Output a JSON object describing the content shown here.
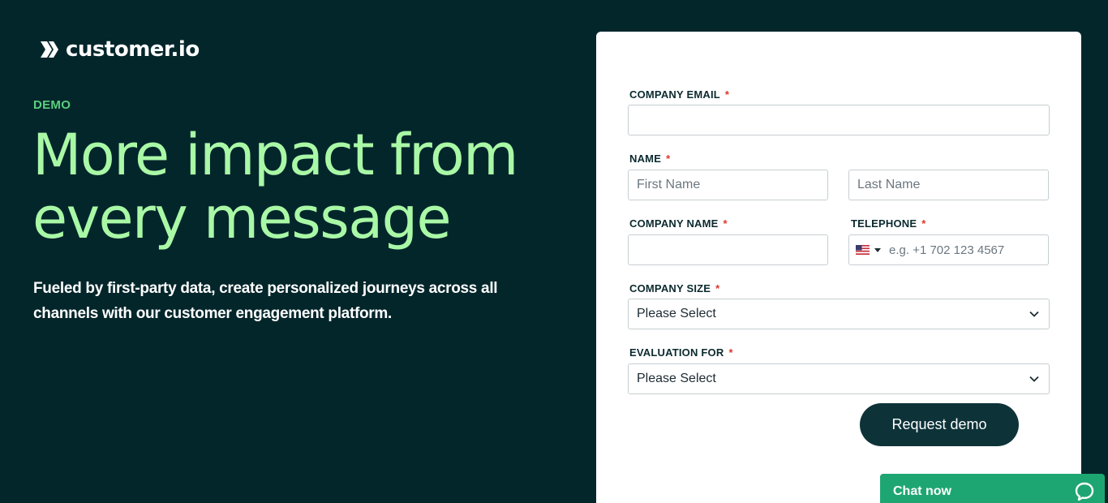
{
  "brand": {
    "name": "customer.io"
  },
  "hero": {
    "eyebrow": "DEMO",
    "headline_line1": "More impact from",
    "headline_line2": "every message",
    "subtext_line1": "Fueled by first-party data, create personalized journeys across all",
    "subtext_line2": "channels with our customer engagement platform."
  },
  "form": {
    "company_email": {
      "label": "COMPANY EMAIL",
      "required": "*",
      "value": ""
    },
    "name": {
      "label": "NAME",
      "required": "*",
      "first_placeholder": "First Name",
      "last_placeholder": "Last Name"
    },
    "company_name": {
      "label": "COMPANY NAME",
      "required": "*",
      "value": ""
    },
    "telephone": {
      "label": "TELEPHONE",
      "required": "*",
      "placeholder": "e.g. +1 702 123 4567",
      "country_flag": "us-flag-icon"
    },
    "company_size": {
      "label": "COMPANY SIZE",
      "required": "*",
      "selected": "Please Select"
    },
    "evaluation_for": {
      "label": "EVALUATION FOR",
      "required": "*",
      "selected": "Please Select"
    },
    "submit_label": "Request demo"
  },
  "chat": {
    "label": "Chat now",
    "icon": "chat-bubble-icon"
  },
  "colors": {
    "background": "#03262b",
    "headline": "#a9f8a6",
    "eyebrow": "#5bcf7e",
    "button": "#0d3339",
    "chat": "#1ea672",
    "required": "#e0352b"
  }
}
